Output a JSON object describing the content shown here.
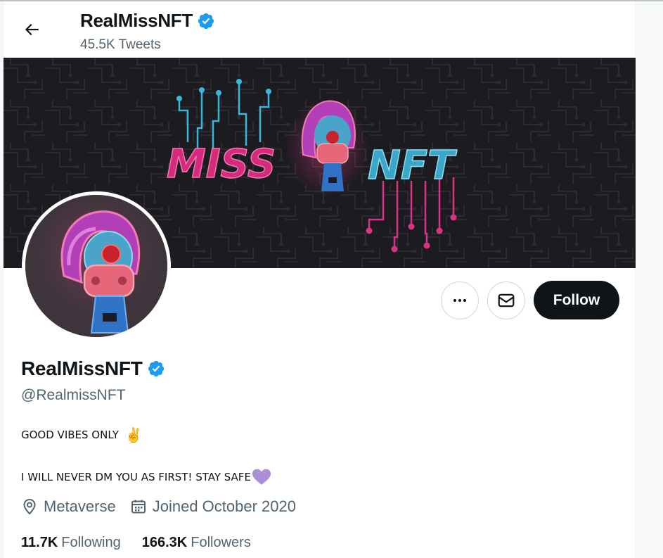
{
  "header": {
    "name": "RealMissNFT",
    "tweet_count": "45.5K Tweets"
  },
  "banner": {
    "logo_left": "MISS",
    "logo_right": "NFT"
  },
  "profile": {
    "name": "RealMissNFT",
    "handle": "@RealmissNFT",
    "bio_line1": "GOOD VIBES ONLY ",
    "bio_line1_emoji": "✌️",
    "bio_line2": "I WILL NEVER DM YOU AS FIRST! STAY SAFE",
    "bio_line2_emoji": "💜",
    "location": "Metaverse",
    "joined": "Joined October 2020",
    "following_count": "11.7K",
    "following_label": "Following",
    "followers_count": "166.3K",
    "followers_label": "Followers"
  },
  "actions": {
    "follow_label": "Follow"
  },
  "icons": {
    "back": "arrow-left-icon",
    "verified": "verified-badge-icon",
    "more": "more-dots-icon",
    "message": "envelope-icon",
    "location": "location-pin-icon",
    "calendar": "calendar-icon"
  },
  "colors": {
    "verified": "#1d9bf0",
    "follow_bg": "#0f1419",
    "secondary_text": "#536471",
    "banner_bg": "#1c1b20",
    "accent_pink": "#e23a8a",
    "accent_cyan": "#3ab6d9"
  }
}
